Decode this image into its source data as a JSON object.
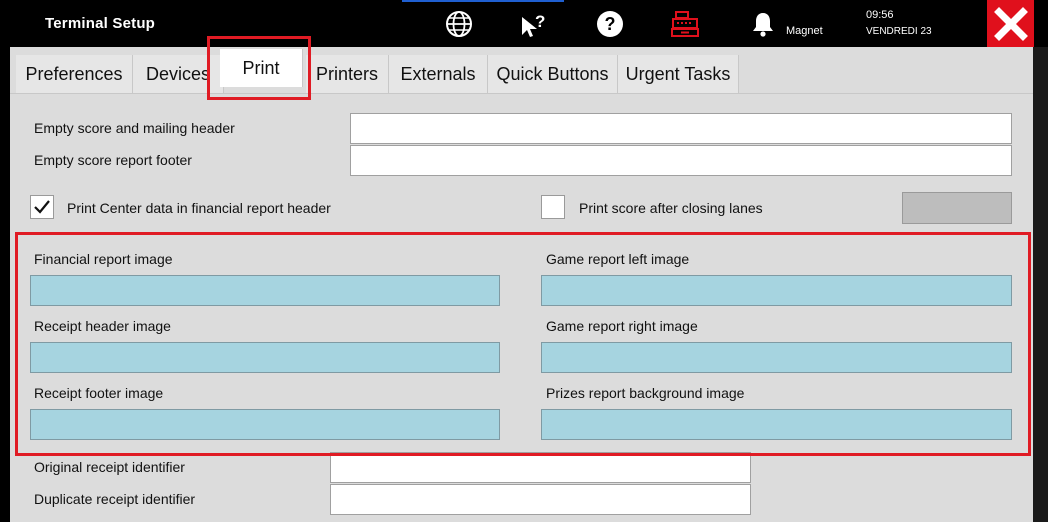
{
  "header": {
    "title": "Terminal Setup",
    "icons": [
      "globe-icon",
      "cursor-help-icon",
      "help-circle-icon",
      "cash-register-icon",
      "bell-icon",
      "close-icon"
    ],
    "user": "Magnet",
    "time": "09:56",
    "date": "VENDREDI 23",
    "colors": {
      "bar": "#000000",
      "close": "#e0101c",
      "register": "#e0101c"
    }
  },
  "tabs": [
    {
      "label": "Preferences"
    },
    {
      "label": "Devices"
    },
    {
      "label": "Print"
    },
    {
      "label": "Printers"
    },
    {
      "label": "Externals"
    },
    {
      "label": "Quick Buttons"
    },
    {
      "label": "Urgent Tasks"
    }
  ],
  "active_tab": "Print",
  "form": {
    "empty_score_header_label": "Empty score and mailing header",
    "empty_score_header_value": "",
    "empty_score_footer_label": "Empty score report footer",
    "empty_score_footer_value": "",
    "print_center_data_label": "Print Center data in financial report header",
    "print_center_data_checked": true,
    "print_score_after_closing_label": "Print score after closing lanes",
    "print_score_after_closing_checked": false,
    "images": {
      "financial_report_image": "Financial report image",
      "receipt_header_image": "Receipt header image",
      "receipt_footer_image": "Receipt footer image",
      "game_report_left_image": "Game report left image",
      "game_report_right_image": "Game report right image",
      "prizes_report_background_image": "Prizes report background image"
    },
    "original_receipt_identifier_label": "Original receipt identifier",
    "original_receipt_identifier_value": "",
    "duplicate_receipt_identifier_label": "Duplicate receipt identifier",
    "duplicate_receipt_identifier_value": ""
  },
  "colors": {
    "panel": "#dcdcdc",
    "image_field": "#a6d4e0",
    "highlight": "#e01b24"
  }
}
